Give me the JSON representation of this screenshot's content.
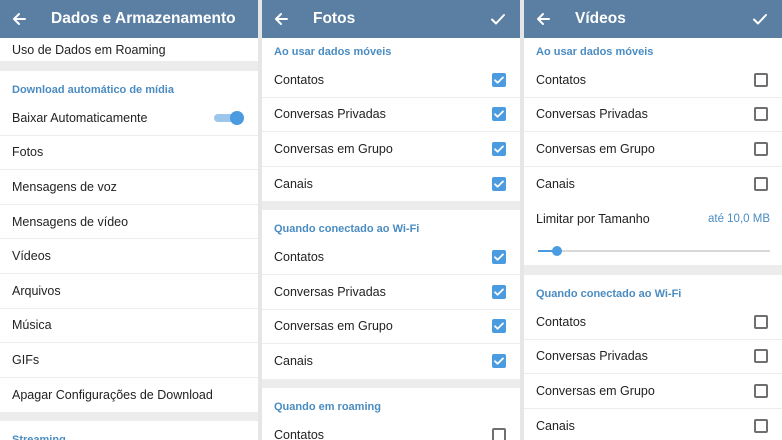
{
  "colors": {
    "header": "#5a7fa3",
    "accent": "#4a8cc2",
    "checkbox_on": "#4a9be0"
  },
  "panel_left": {
    "title": "Dados e Armazenamento",
    "top_item": "Uso de Dados em Roaming",
    "section_auto": "Download automático de mídia",
    "auto_download": {
      "label": "Baixar Automaticamente",
      "enabled": true
    },
    "items": [
      "Fotos",
      "Mensagens de voz",
      "Mensagens de vídeo",
      "Vídeos",
      "Arquivos",
      "Música",
      "GIFs",
      "Apagar Configurações de Download"
    ],
    "section_streaming": "Streaming"
  },
  "panel_photos": {
    "title": "Fotos",
    "section_mobile": "Ao usar dados móveis",
    "mobile": [
      {
        "label": "Contatos",
        "checked": true
      },
      {
        "label": "Conversas Privadas",
        "checked": true
      },
      {
        "label": "Conversas em Grupo",
        "checked": true
      },
      {
        "label": "Canais",
        "checked": true
      }
    ],
    "section_wifi": "Quando conectado ao Wi-Fi",
    "wifi": [
      {
        "label": "Contatos",
        "checked": true
      },
      {
        "label": "Conversas Privadas",
        "checked": true
      },
      {
        "label": "Conversas em Grupo",
        "checked": true
      },
      {
        "label": "Canais",
        "checked": true
      }
    ],
    "section_roaming": "Quando em roaming",
    "roaming": [
      {
        "label": "Contatos",
        "checked": false
      }
    ]
  },
  "panel_videos": {
    "title": "Vídeos",
    "section_mobile": "Ao usar dados móveis",
    "mobile": [
      {
        "label": "Contatos",
        "checked": false
      },
      {
        "label": "Conversas Privadas",
        "checked": false
      },
      {
        "label": "Conversas em Grupo",
        "checked": false
      },
      {
        "label": "Canais",
        "checked": false
      }
    ],
    "size_limit": {
      "label": "Limitar por Tamanho",
      "value": "até 10,0 MB",
      "slider_fraction": 0.08
    },
    "section_wifi": "Quando conectado ao Wi-Fi",
    "wifi": [
      {
        "label": "Contatos",
        "checked": false
      },
      {
        "label": "Conversas Privadas",
        "checked": false
      },
      {
        "label": "Conversas em Grupo",
        "checked": false
      },
      {
        "label": "Canais",
        "checked": false
      }
    ]
  }
}
